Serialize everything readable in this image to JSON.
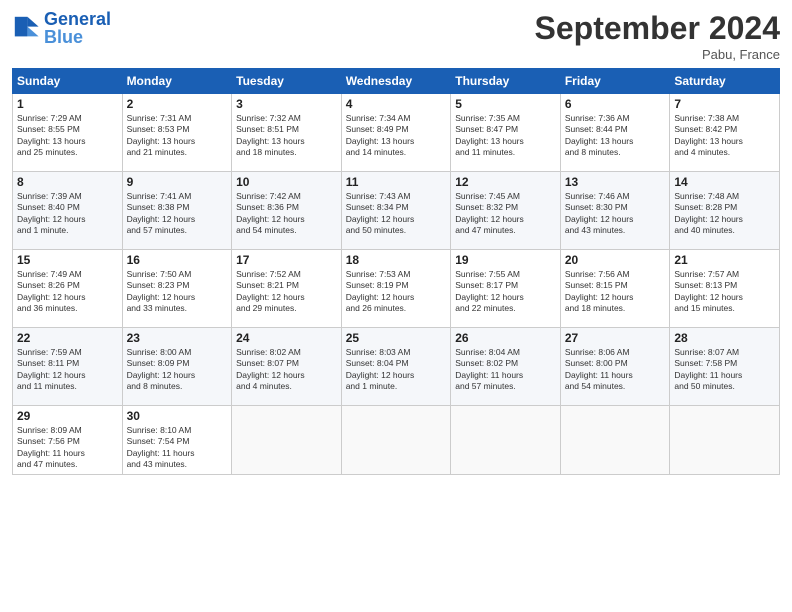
{
  "header": {
    "logo_general": "General",
    "logo_blue": "Blue",
    "month_title": "September 2024",
    "location": "Pabu, France"
  },
  "weekdays": [
    "Sunday",
    "Monday",
    "Tuesday",
    "Wednesday",
    "Thursday",
    "Friday",
    "Saturday"
  ],
  "weeks": [
    [
      {
        "day": "1",
        "sunrise": "7:29 AM",
        "sunset": "8:55 PM",
        "daylight": "13 hours and 25 minutes."
      },
      {
        "day": "2",
        "sunrise": "7:31 AM",
        "sunset": "8:53 PM",
        "daylight": "13 hours and 21 minutes."
      },
      {
        "day": "3",
        "sunrise": "7:32 AM",
        "sunset": "8:51 PM",
        "daylight": "13 hours and 18 minutes."
      },
      {
        "day": "4",
        "sunrise": "7:34 AM",
        "sunset": "8:49 PM",
        "daylight": "13 hours and 14 minutes."
      },
      {
        "day": "5",
        "sunrise": "7:35 AM",
        "sunset": "8:47 PM",
        "daylight": "13 hours and 11 minutes."
      },
      {
        "day": "6",
        "sunrise": "7:36 AM",
        "sunset": "8:44 PM",
        "daylight": "13 hours and 8 minutes."
      },
      {
        "day": "7",
        "sunrise": "7:38 AM",
        "sunset": "8:42 PM",
        "daylight": "13 hours and 4 minutes."
      }
    ],
    [
      {
        "day": "8",
        "sunrise": "7:39 AM",
        "sunset": "8:40 PM",
        "daylight": "12 hours and 1 minute."
      },
      {
        "day": "9",
        "sunrise": "7:41 AM",
        "sunset": "8:38 PM",
        "daylight": "12 hours and 57 minutes."
      },
      {
        "day": "10",
        "sunrise": "7:42 AM",
        "sunset": "8:36 PM",
        "daylight": "12 hours and 54 minutes."
      },
      {
        "day": "11",
        "sunrise": "7:43 AM",
        "sunset": "8:34 PM",
        "daylight": "12 hours and 50 minutes."
      },
      {
        "day": "12",
        "sunrise": "7:45 AM",
        "sunset": "8:32 PM",
        "daylight": "12 hours and 47 minutes."
      },
      {
        "day": "13",
        "sunrise": "7:46 AM",
        "sunset": "8:30 PM",
        "daylight": "12 hours and 43 minutes."
      },
      {
        "day": "14",
        "sunrise": "7:48 AM",
        "sunset": "8:28 PM",
        "daylight": "12 hours and 40 minutes."
      }
    ],
    [
      {
        "day": "15",
        "sunrise": "7:49 AM",
        "sunset": "8:26 PM",
        "daylight": "12 hours and 36 minutes."
      },
      {
        "day": "16",
        "sunrise": "7:50 AM",
        "sunset": "8:23 PM",
        "daylight": "12 hours and 33 minutes."
      },
      {
        "day": "17",
        "sunrise": "7:52 AM",
        "sunset": "8:21 PM",
        "daylight": "12 hours and 29 minutes."
      },
      {
        "day": "18",
        "sunrise": "7:53 AM",
        "sunset": "8:19 PM",
        "daylight": "12 hours and 26 minutes."
      },
      {
        "day": "19",
        "sunrise": "7:55 AM",
        "sunset": "8:17 PM",
        "daylight": "12 hours and 22 minutes."
      },
      {
        "day": "20",
        "sunrise": "7:56 AM",
        "sunset": "8:15 PM",
        "daylight": "12 hours and 18 minutes."
      },
      {
        "day": "21",
        "sunrise": "7:57 AM",
        "sunset": "8:13 PM",
        "daylight": "12 hours and 15 minutes."
      }
    ],
    [
      {
        "day": "22",
        "sunrise": "7:59 AM",
        "sunset": "8:11 PM",
        "daylight": "12 hours and 11 minutes."
      },
      {
        "day": "23",
        "sunrise": "8:00 AM",
        "sunset": "8:09 PM",
        "daylight": "12 hours and 8 minutes."
      },
      {
        "day": "24",
        "sunrise": "8:02 AM",
        "sunset": "8:07 PM",
        "daylight": "12 hours and 4 minutes."
      },
      {
        "day": "25",
        "sunrise": "8:03 AM",
        "sunset": "8:04 PM",
        "daylight": "12 hours and 1 minute."
      },
      {
        "day": "26",
        "sunrise": "8:04 AM",
        "sunset": "8:02 PM",
        "daylight": "11 hours and 57 minutes."
      },
      {
        "day": "27",
        "sunrise": "8:06 AM",
        "sunset": "8:00 PM",
        "daylight": "11 hours and 54 minutes."
      },
      {
        "day": "28",
        "sunrise": "8:07 AM",
        "sunset": "7:58 PM",
        "daylight": "11 hours and 50 minutes."
      }
    ],
    [
      {
        "day": "29",
        "sunrise": "8:09 AM",
        "sunset": "7:56 PM",
        "daylight": "11 hours and 47 minutes."
      },
      {
        "day": "30",
        "sunrise": "8:10 AM",
        "sunset": "7:54 PM",
        "daylight": "11 hours and 43 minutes."
      },
      null,
      null,
      null,
      null,
      null
    ]
  ]
}
